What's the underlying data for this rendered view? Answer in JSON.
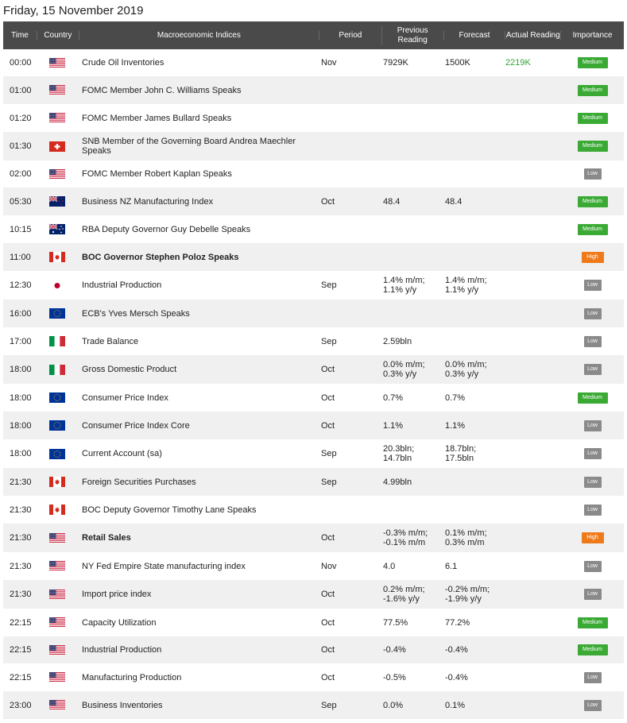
{
  "date_heading": "Friday, 15 November 2019",
  "headers": {
    "time": "Time",
    "country": "Country",
    "indices": "Macroeconomic Indices",
    "period": "Period",
    "previous_line1": "Previous",
    "previous_line2": "Reading",
    "forecast": "Forecast",
    "actual": "Actual Reading",
    "importance": "Importance"
  },
  "colors": {
    "medium": "#3aaa35",
    "low": "#8a8a8a",
    "high": "#ef7a1a",
    "actual_text": "#33a333",
    "header_bg": "#4a4a4a"
  },
  "rows": [
    {
      "time": "00:00",
      "country": "us",
      "name": "Crude Oil Inventories",
      "bold": false,
      "period": "Nov",
      "prev": [
        "7929K"
      ],
      "forecast": [
        "1500K"
      ],
      "actual": "2219K",
      "importance": "Medium",
      "h": 34
    },
    {
      "time": "01:00",
      "country": "us",
      "name": "FOMC Member John C. Williams Speaks",
      "bold": false,
      "period": "",
      "prev": [],
      "forecast": [],
      "actual": "",
      "importance": "Medium",
      "h": 35
    },
    {
      "time": "01:20",
      "country": "us",
      "name": "FOMC Member James Bullard Speaks",
      "bold": false,
      "period": "",
      "prev": [],
      "forecast": [],
      "actual": "",
      "importance": "Medium",
      "h": 35
    },
    {
      "time": "01:30",
      "country": "ch",
      "name": "SNB Member of the Governing Board Andrea Maechler Speaks",
      "bold": false,
      "period": "",
      "prev": [],
      "forecast": [],
      "actual": "",
      "importance": "Medium",
      "h": 36
    },
    {
      "time": "02:00",
      "country": "us",
      "name": "FOMC Member Robert Kaplan Speaks",
      "bold": false,
      "period": "",
      "prev": [],
      "forecast": [],
      "actual": "",
      "importance": "Low",
      "h": 34
    },
    {
      "time": "05:30",
      "country": "nz",
      "name": "Business NZ Manufacturing Index",
      "bold": false,
      "period": "Oct",
      "prev": [
        "48.4"
      ],
      "forecast": [
        "48.4"
      ],
      "actual": "",
      "importance": "Medium",
      "h": 35
    },
    {
      "time": "10:15",
      "country": "au",
      "name": "RBA Deputy Governor Guy Debelle Speaks",
      "bold": false,
      "period": "",
      "prev": [],
      "forecast": [],
      "actual": "",
      "importance": "Medium",
      "h": 35
    },
    {
      "time": "11:00",
      "country": "ca",
      "name": "BOC Governor Stephen Poloz Speaks",
      "bold": true,
      "period": "",
      "prev": [],
      "forecast": [],
      "actual": "",
      "importance": "High",
      "h": 35
    },
    {
      "time": "12:30",
      "country": "jp",
      "name": "Industrial Production",
      "bold": false,
      "period": "Sep",
      "prev": [
        "1.4% m/m;",
        "1.1% y/y"
      ],
      "forecast": [
        "1.4% m/m;",
        "1.1% y/y"
      ],
      "actual": "",
      "importance": "Low",
      "h": 36
    },
    {
      "time": "16:00",
      "country": "eu",
      "name": "ECB's Yves Mersch Speaks",
      "bold": false,
      "period": "",
      "prev": [],
      "forecast": [],
      "actual": "",
      "importance": "Low",
      "h": 35
    },
    {
      "time": "17:00",
      "country": "it",
      "name": "Trade Balance",
      "bold": false,
      "period": "Sep",
      "prev": [
        "2.59bln"
      ],
      "forecast": [],
      "actual": "",
      "importance": "Low",
      "h": 35
    },
    {
      "time": "18:00",
      "country": "it",
      "name": "Gross Domestic Product",
      "bold": false,
      "period": "Oct",
      "prev": [
        "0.0% m/m;",
        "0.3% y/y"
      ],
      "forecast": [
        "0.0% m/m;",
        "0.3% y/y"
      ],
      "actual": "",
      "importance": "Low",
      "h": 36
    },
    {
      "time": "18:00",
      "country": "eu",
      "name": "Consumer Price Index",
      "bold": false,
      "period": "Oct",
      "prev": [
        "0.7%"
      ],
      "forecast": [
        "0.7%"
      ],
      "actual": "",
      "importance": "Medium",
      "h": 35
    },
    {
      "time": "18:00",
      "country": "eu",
      "name": "Consumer Price Index Core",
      "bold": false,
      "period": "Oct",
      "prev": [
        "1.1%"
      ],
      "forecast": [
        "1.1%"
      ],
      "actual": "",
      "importance": "Low",
      "h": 35
    },
    {
      "time": "18:00",
      "country": "eu",
      "name": "Current Account (sa)",
      "bold": false,
      "period": "Sep",
      "prev": [
        "20.3bln;",
        "14.7bln"
      ],
      "forecast": [
        "18.7bln;",
        "17.5bln"
      ],
      "actual": "",
      "importance": "Low",
      "h": 36
    },
    {
      "time": "21:30",
      "country": "ca",
      "name": "Foreign Securities Purchases",
      "bold": false,
      "period": "Sep",
      "prev": [
        "4.99bln"
      ],
      "forecast": [],
      "actual": "",
      "importance": "Low",
      "h": 35
    },
    {
      "time": "21:30",
      "country": "ca",
      "name": "BOC Deputy Governor Timothy Lane Speaks",
      "bold": false,
      "period": "",
      "prev": [],
      "forecast": [],
      "actual": "",
      "importance": "Low",
      "h": 35
    },
    {
      "time": "21:30",
      "country": "us",
      "name": "Retail Sales",
      "bold": true,
      "period": "Oct",
      "prev": [
        "-0.3% m/m;",
        "-0.1% m/m"
      ],
      "forecast": [
        "0.1% m/m;",
        "0.3% m/m"
      ],
      "actual": "",
      "importance": "High",
      "h": 36
    },
    {
      "time": "21:30",
      "country": "us",
      "name": "NY Fed Empire State manufacturing index",
      "bold": false,
      "period": "Nov",
      "prev": [
        "4.0"
      ],
      "forecast": [
        "6.1"
      ],
      "actual": "",
      "importance": "Low",
      "h": 35
    },
    {
      "time": "21:30",
      "country": "us",
      "name": "Import price index",
      "bold": false,
      "period": "Oct",
      "prev": [
        "0.2% m/m;",
        "-1.6% y/y"
      ],
      "forecast": [
        "-0.2% m/m;",
        "-1.9% y/y"
      ],
      "actual": "",
      "importance": "Low",
      "h": 36
    },
    {
      "time": "22:15",
      "country": "us",
      "name": "Capacity Utilization",
      "bold": false,
      "period": "Oct",
      "prev": [
        "77.5%"
      ],
      "forecast": [
        "77.2%"
      ],
      "actual": "",
      "importance": "Medium",
      "h": 35
    },
    {
      "time": "22:15",
      "country": "us",
      "name": "Industrial Production",
      "bold": false,
      "period": "Oct",
      "prev": [
        "-0.4%"
      ],
      "forecast": [
        "-0.4%"
      ],
      "actual": "",
      "importance": "Medium",
      "h": 34
    },
    {
      "time": "22:15",
      "country": "us",
      "name": "Manufacturing Production",
      "bold": false,
      "period": "Oct",
      "prev": [
        "-0.5%"
      ],
      "forecast": [
        "-0.4%"
      ],
      "actual": "",
      "importance": "Low",
      "h": 35
    },
    {
      "time": "23:00",
      "country": "us",
      "name": "Business Inventories",
      "bold": false,
      "period": "Sep",
      "prev": [
        "0.0%"
      ],
      "forecast": [
        "0.1%"
      ],
      "actual": "",
      "importance": "Low",
      "h": 35
    }
  ]
}
